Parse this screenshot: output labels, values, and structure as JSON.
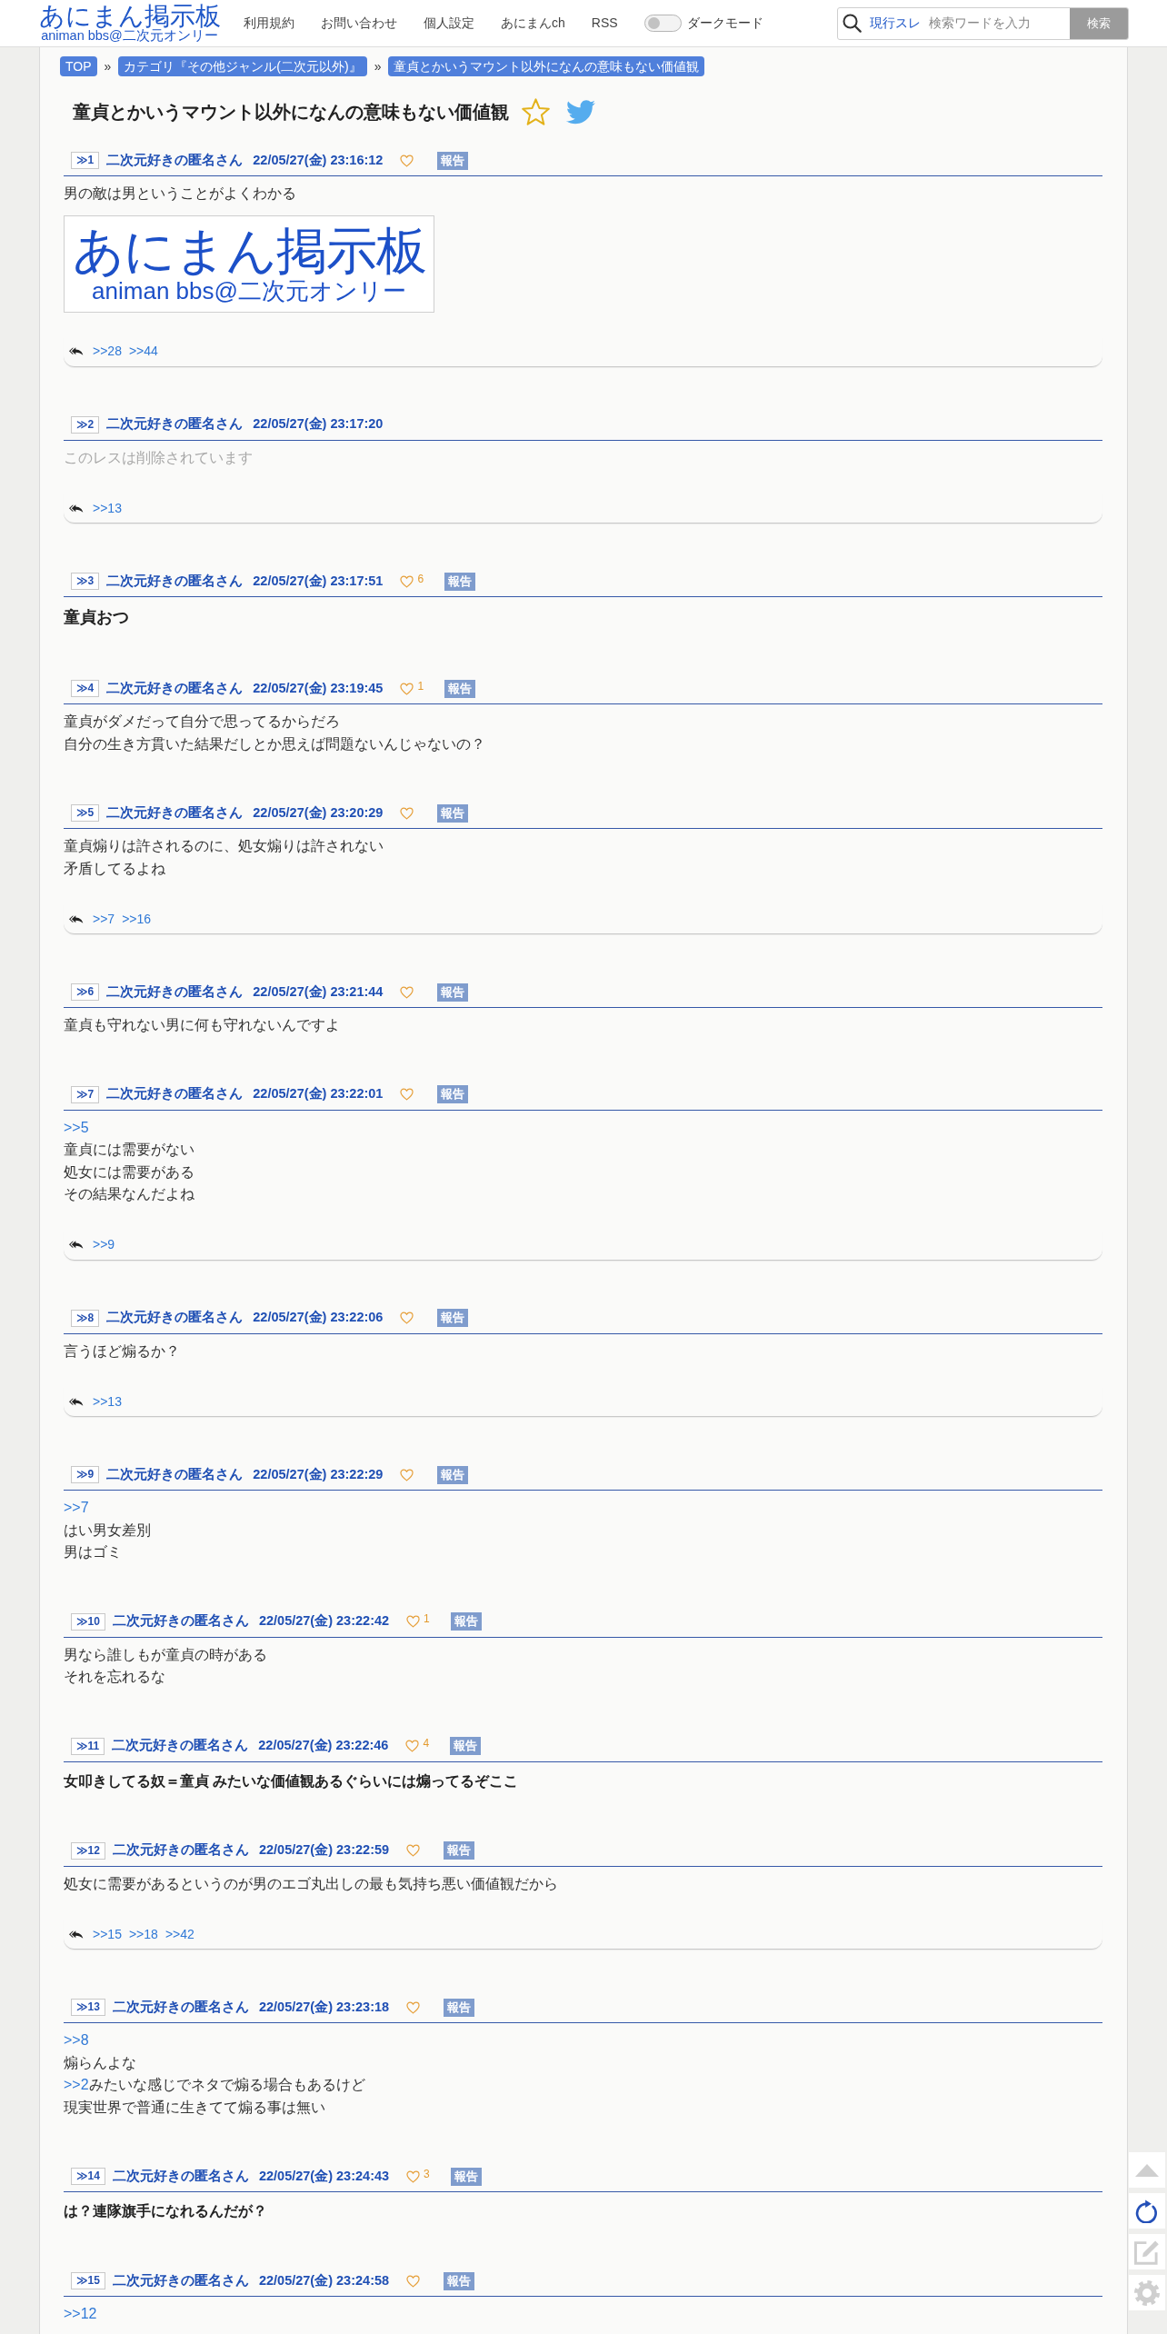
{
  "header": {
    "logo_title": "あにまん掲示板",
    "logo_subtitle": "animan bbs@二次元オンリー",
    "nav": [
      "利用規約",
      "お問い合わせ",
      "個人設定",
      "あにまんch",
      "RSS"
    ],
    "dark_mode": {
      "label": "ダークモード",
      "on": false
    },
    "search": {
      "scope": "現行スレ",
      "placeholder": "検索ワードを入力",
      "button": "検索"
    }
  },
  "breadcrumb": [
    {
      "kind": "link",
      "label": "TOP"
    },
    {
      "kind": "separator",
      "label": "»"
    },
    {
      "kind": "link",
      "label": "カテゴリ『その他ジャンル(二次元以外)』"
    },
    {
      "kind": "separator",
      "label": "»"
    },
    {
      "kind": "link",
      "label": "童貞とかいうマウント以外になんの意味もない価値観"
    }
  ],
  "thread": {
    "title": "童貞とかいうマウント以外になんの意味もない価値観",
    "favorite": false
  },
  "posts": [
    {
      "no": "≫1",
      "name": "二次元好きの匿名さん",
      "date": "22/05/27(金) 23:16:12",
      "report": "報告",
      "lines": [
        "男の敵は男ということがよくわかる"
      ],
      "image": {
        "title": "あにまん掲示板",
        "subtitle": "animan bbs@二次元オンリー"
      },
      "replies": [
        ">>28",
        ">>44"
      ]
    },
    {
      "no": "≫2",
      "name": "二次元好きの匿名さん",
      "date": "22/05/27(金) 23:17:20",
      "deleted": true,
      "lines": [
        "このレスは削除されています"
      ],
      "replies": [
        ">>13"
      ]
    },
    {
      "no": "≫3",
      "name": "二次元好きの匿名さん",
      "date": "22/05/27(金) 23:17:51",
      "likes": "6",
      "report": "報告",
      "bold": true,
      "large": true,
      "lines": [
        "童貞おつ"
      ]
    },
    {
      "no": "≫4",
      "name": "二次元好きの匿名さん",
      "date": "22/05/27(金) 23:19:45",
      "likes": "1",
      "report": "報告",
      "lines": [
        "童貞がダメだって自分で思ってるからだろ",
        "自分の生き方貫いた結果だしとか思えば問題ないんじゃないの？"
      ]
    },
    {
      "no": "≫5",
      "name": "二次元好きの匿名さん",
      "date": "22/05/27(金) 23:20:29",
      "report": "報告",
      "lines": [
        "童貞煽りは許されるのに、処女煽りは許されない",
        "矛盾してるよね"
      ],
      "replies": [
        ">>7",
        ">>16"
      ]
    },
    {
      "no": "≫6",
      "name": "二次元好きの匿名さん",
      "date": "22/05/27(金) 23:21:44",
      "report": "報告",
      "lines": [
        "童貞も守れない男に何も守れないんですよ"
      ]
    },
    {
      "no": "≫7",
      "name": "二次元好きの匿名さん",
      "date": "22/05/27(金) 23:22:01",
      "report": "報告",
      "lines": [
        {
          "anchor": ">>5"
        },
        "童貞には需要がない",
        "処女には需要がある",
        "その結果なんだよね"
      ],
      "replies": [
        ">>9"
      ]
    },
    {
      "no": "≫8",
      "name": "二次元好きの匿名さん",
      "date": "22/05/27(金) 23:22:06",
      "report": "報告",
      "lines": [
        "言うほど煽るか？"
      ],
      "replies": [
        ">>13"
      ]
    },
    {
      "no": "≫9",
      "name": "二次元好きの匿名さん",
      "date": "22/05/27(金) 23:22:29",
      "report": "報告",
      "lines": [
        {
          "anchor": ">>7"
        },
        "はい男女差別",
        "男はゴミ"
      ]
    },
    {
      "no": "≫10",
      "name": "二次元好きの匿名さん",
      "date": "22/05/27(金) 23:22:42",
      "likes": "1",
      "report": "報告",
      "lines": [
        "男なら誰しもが童貞の時がある",
        "それを忘れるな"
      ]
    },
    {
      "no": "≫11",
      "name": "二次元好きの匿名さん",
      "date": "22/05/27(金) 23:22:46",
      "likes": "4",
      "report": "報告",
      "bold": true,
      "lines": [
        "女叩きしてる奴＝童貞 みたいな価値観あるぐらいには煽ってるぞここ"
      ]
    },
    {
      "no": "≫12",
      "name": "二次元好きの匿名さん",
      "date": "22/05/27(金) 23:22:59",
      "report": "報告",
      "lines": [
        "処女に需要があるというのが男のエゴ丸出しの最も気持ち悪い価値観だから"
      ],
      "replies": [
        ">>15",
        ">>18",
        ">>42"
      ]
    },
    {
      "no": "≫13",
      "name": "二次元好きの匿名さん",
      "date": "22/05/27(金) 23:23:18",
      "report": "報告",
      "lines": [
        {
          "anchor": ">>8"
        },
        "煽らんよな",
        {
          "anchor": ">>2",
          "text": "みたいな感じでネタで煽る場合もあるけど"
        },
        "現実世界で普通に生きてて煽る事は無い"
      ]
    },
    {
      "no": "≫14",
      "name": "二次元好きの匿名さん",
      "date": "22/05/27(金) 23:24:43",
      "likes": "3",
      "report": "報告",
      "bold": true,
      "lines": [
        "は？連隊旗手になれるんだが？"
      ]
    },
    {
      "no": "≫15",
      "name": "二次元好きの匿名さん",
      "date": "22/05/27(金) 23:24:58",
      "report": "報告",
      "lines": [
        {
          "anchor": ">>12"
        }
      ]
    }
  ],
  "side_buttons": [
    {
      "kind": "top"
    },
    {
      "kind": "reload"
    },
    {
      "kind": "write"
    },
    {
      "kind": "settings"
    }
  ]
}
